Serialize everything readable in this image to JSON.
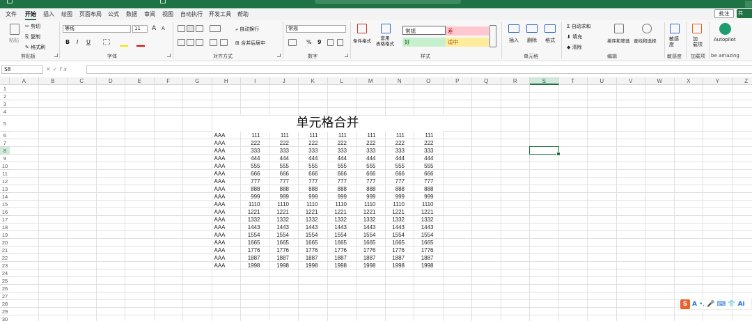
{
  "menu": [
    "文件",
    "开始",
    "插入",
    "绘图",
    "页面布局",
    "公式",
    "数据",
    "审阅",
    "视图",
    "自动执行",
    "开发工具",
    "帮助"
  ],
  "menu_active": "开始",
  "comment_label": "批注",
  "share_label": "共",
  "ribbon": {
    "clipboard": {
      "paste": "粘贴",
      "cut": "剪切",
      "copy": "复制",
      "format_painter": "格式刷",
      "label": "剪贴板"
    },
    "font": {
      "name": "等线",
      "size": "11",
      "bold": "B",
      "italic": "I",
      "underline": "U",
      "grow": "A",
      "shrink": "A",
      "label": "字体"
    },
    "alignment": {
      "wrap": "自动换行",
      "merge": "合并后居中",
      "label": "对齐方式"
    },
    "number": {
      "format": "常规",
      "label": "数字",
      "percent": "%",
      "comma": "9"
    },
    "styles": {
      "cond": "条件格式",
      "table": "套用\n表格格式",
      "normal": "常规",
      "bad": "差",
      "good": "好",
      "neutral": "适中",
      "label": "样式"
    },
    "cells": {
      "insert": "插入",
      "delete": "删除",
      "format": "格式",
      "label": "单元格"
    },
    "editing": {
      "autosum": "自动求和",
      "fill": "填充",
      "clear": "清除",
      "sort": "排序和筛选",
      "find": "查找和选择",
      "label": "编辑"
    },
    "sensitivity": {
      "btn": "敏感\n度",
      "label": "敏感度"
    },
    "addins": {
      "btn": "加\n载项",
      "label": "加载项"
    },
    "autopilot": {
      "btn": "Autopilot",
      "label": "be amazing"
    }
  },
  "formula_bar": {
    "name_box": "S8",
    "fx": "fx",
    "value": ""
  },
  "columns": [
    "A",
    "B",
    "C",
    "D",
    "E",
    "F",
    "G",
    "H",
    "I",
    "J",
    "K",
    "L",
    "M",
    "N",
    "O",
    "P",
    "Q",
    "R",
    "S",
    "T",
    "U",
    "V",
    "W",
    "X",
    "Y",
    "Z"
  ],
  "selected_column": "S",
  "rows": [
    1,
    2,
    3,
    4,
    5,
    6,
    7,
    8,
    9,
    10,
    11,
    12,
    13,
    14,
    15,
    16,
    17,
    18,
    19,
    20,
    21,
    22,
    23,
    24,
    25,
    26,
    27,
    28,
    29,
    30
  ],
  "selected_row": 8,
  "sheet": {
    "title": "单元格合并",
    "label_col": "AAA",
    "values": [
      "111",
      "222",
      "333",
      "444",
      "555",
      "666",
      "777",
      "888",
      "999",
      "1110",
      "1221",
      "1332",
      "1443",
      "1554",
      "1665",
      "1776",
      "1887",
      "1998"
    ]
  },
  "ime": {
    "letter": "S",
    "mode": "A"
  }
}
